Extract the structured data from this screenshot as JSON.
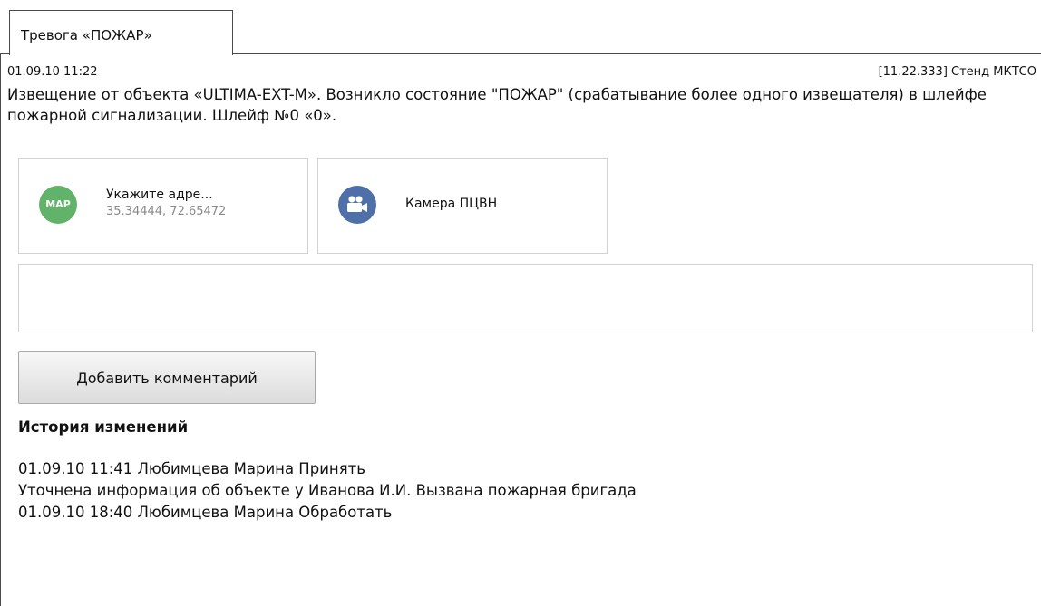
{
  "tab": {
    "label": "Тревога «ПОЖАР»"
  },
  "event": {
    "datetime": "01.09.10 11:22",
    "source": "[11.22.333] Стенд МКТСО",
    "message": "Извещение от объекта «ULTIMA-EXT-M». Возникло состояние \"ПОЖАР\" (срабатывание более одного извещателя) в шлейфе пожарной сигнализации. Шлейф №0 «0»."
  },
  "cards": {
    "map": {
      "icon_label": "MAP",
      "icon": "map-badge-icon",
      "icon_color": "#62b36a",
      "title": "Укажите адре...",
      "coords": "35.34444, 72.65472"
    },
    "camera": {
      "icon": "video-camera-icon",
      "icon_color": "#4e6fa7",
      "title": "Камера ПЦВН"
    }
  },
  "comment": {
    "value": "",
    "placeholder": ""
  },
  "buttons": {
    "add_comment": "Добавить комментарий"
  },
  "history": {
    "title": "История изменений",
    "entries": [
      "01.09.10 11:41 Любимцева Марина Принять",
      "Уточнена информация об объекте у Иванова И.И. Вызвана пожарная бригада",
      "01.09.10 18:40 Любимцева Марина Обработать"
    ]
  }
}
